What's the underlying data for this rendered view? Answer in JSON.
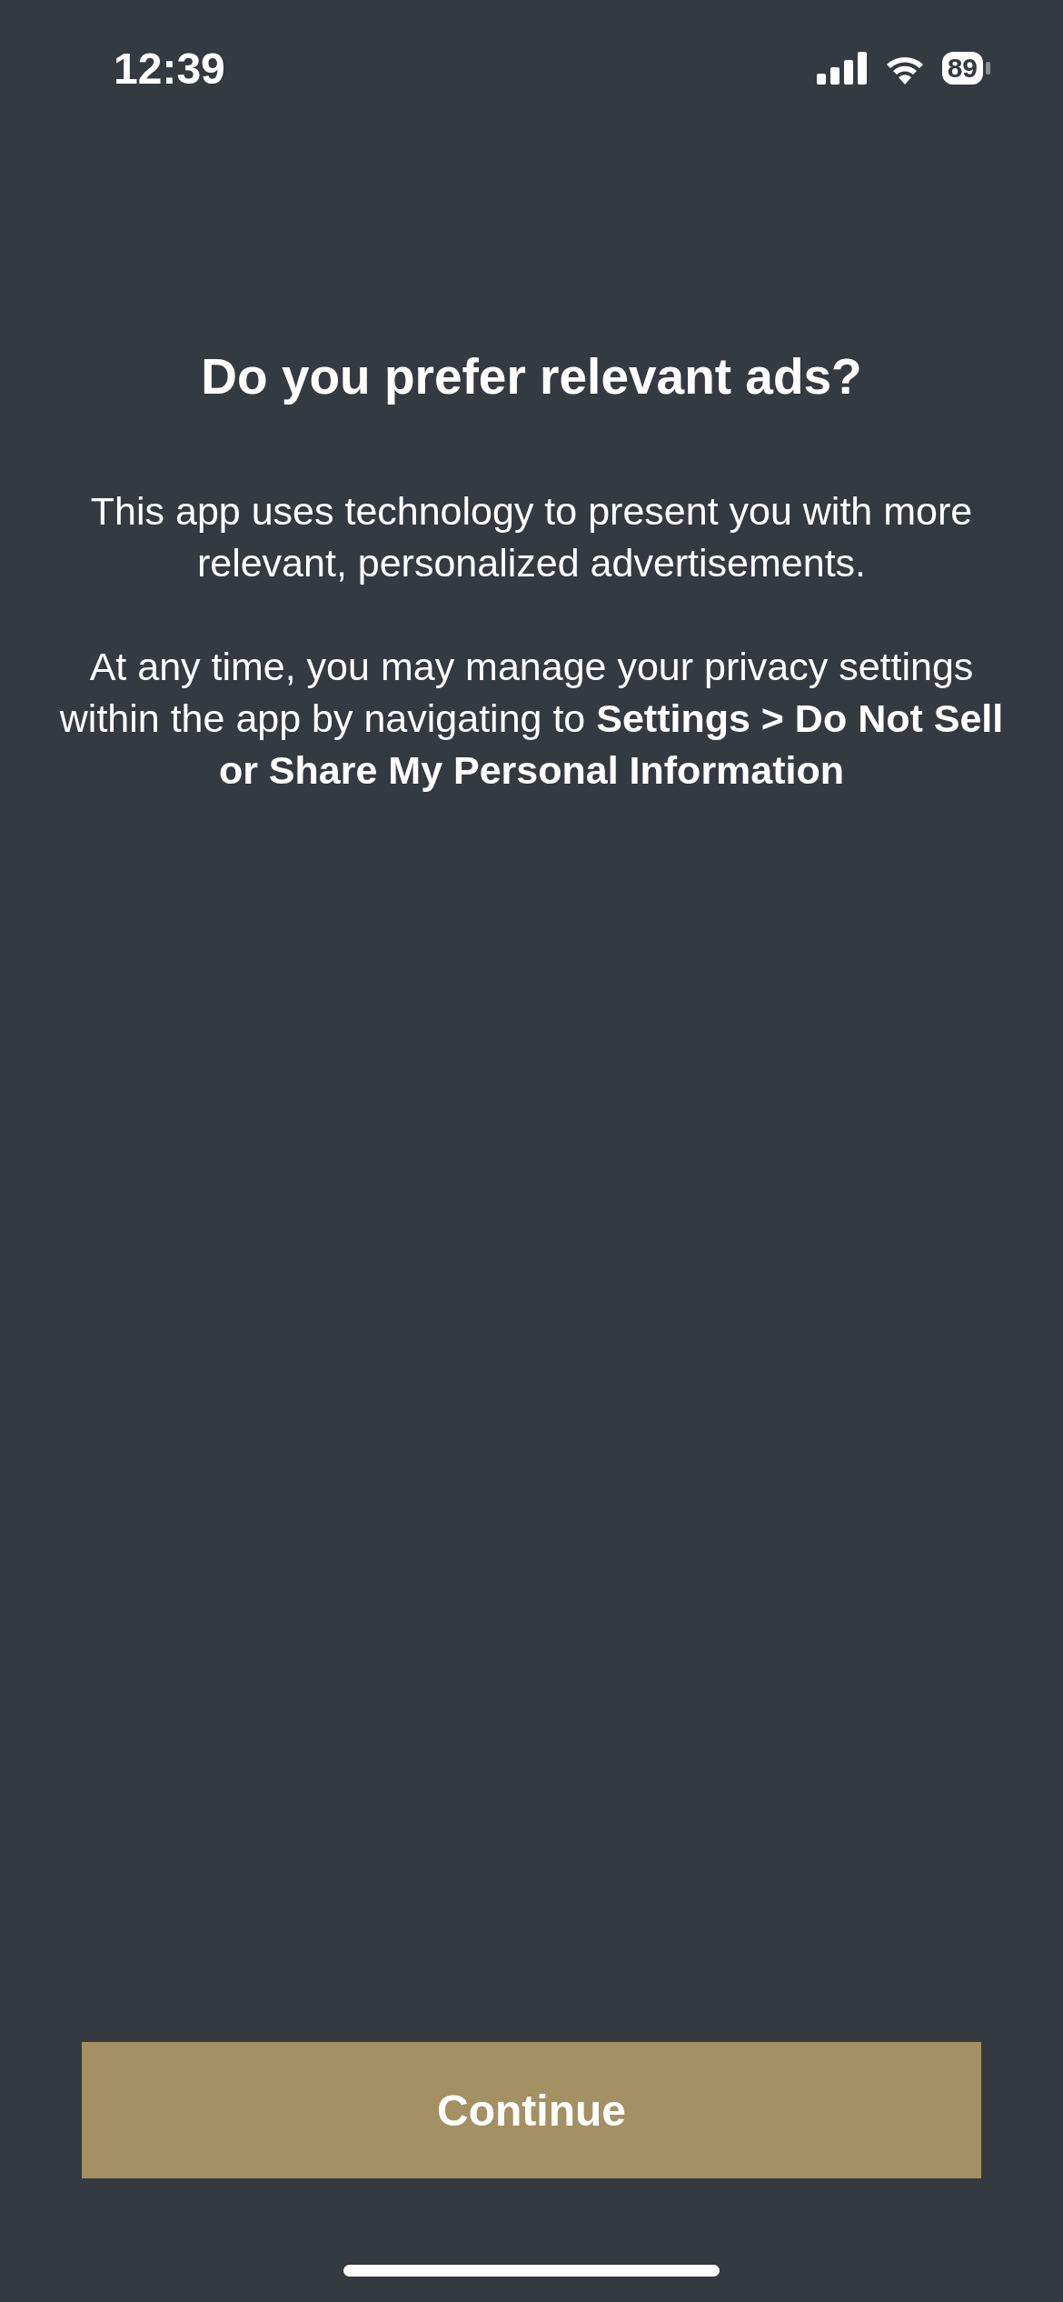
{
  "status_bar": {
    "time": "12:39",
    "battery": "89"
  },
  "title": "Do you prefer relevant ads?",
  "paragraphs": [
    "This app uses technology to present you with more relevant, personalized advertisements.",
    "At any time, you may manage your privacy settings within the app by navigating to **Settings > Do Not Sell or Share My Personal Information**"
  ],
  "button": {
    "label": "Continue"
  }
}
